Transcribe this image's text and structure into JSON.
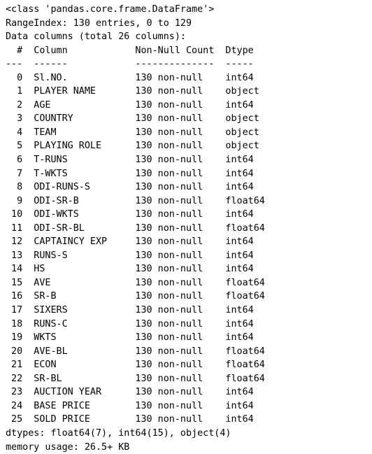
{
  "output": {
    "kind": "pandas-dataframe-info",
    "class_line": "<class 'pandas.core.frame.DataFrame'>",
    "range_index_line": "RangeIndex: 130 entries, 0 to 129",
    "data_columns_line": "Data columns (total 26 columns):",
    "entries_count": 130,
    "index_start": 0,
    "index_end": 129,
    "total_columns": 26,
    "headers": {
      "index": "#",
      "column": "Column",
      "non_null_count": "Non-Null Count",
      "dtype": "Dtype"
    },
    "header_rules": {
      "index": "---",
      "column": "------",
      "non_null_count": "--------------",
      "dtype": "-----"
    },
    "columns": [
      {
        "index": "0",
        "name": "Sl.NO.",
        "non_null": "130 non-null",
        "dtype": "int64"
      },
      {
        "index": "1",
        "name": "PLAYER NAME",
        "non_null": "130 non-null",
        "dtype": "object"
      },
      {
        "index": "2",
        "name": "AGE",
        "non_null": "130 non-null",
        "dtype": "int64"
      },
      {
        "index": "3",
        "name": "COUNTRY",
        "non_null": "130 non-null",
        "dtype": "object"
      },
      {
        "index": "4",
        "name": "TEAM",
        "non_null": "130 non-null",
        "dtype": "object"
      },
      {
        "index": "5",
        "name": "PLAYING ROLE",
        "non_null": "130 non-null",
        "dtype": "object"
      },
      {
        "index": "6",
        "name": "T-RUNS",
        "non_null": "130 non-null",
        "dtype": "int64"
      },
      {
        "index": "7",
        "name": "T-WKTS",
        "non_null": "130 non-null",
        "dtype": "int64"
      },
      {
        "index": "8",
        "name": "ODI-RUNS-S",
        "non_null": "130 non-null",
        "dtype": "int64"
      },
      {
        "index": "9",
        "name": "ODI-SR-B",
        "non_null": "130 non-null",
        "dtype": "float64"
      },
      {
        "index": "10",
        "name": "ODI-WKTS",
        "non_null": "130 non-null",
        "dtype": "int64"
      },
      {
        "index": "11",
        "name": "ODI-SR-BL",
        "non_null": "130 non-null",
        "dtype": "float64"
      },
      {
        "index": "12",
        "name": "CAPTAINCY EXP",
        "non_null": "130 non-null",
        "dtype": "int64"
      },
      {
        "index": "13",
        "name": "RUNS-S",
        "non_null": "130 non-null",
        "dtype": "int64"
      },
      {
        "index": "14",
        "name": "HS",
        "non_null": "130 non-null",
        "dtype": "int64"
      },
      {
        "index": "15",
        "name": "AVE",
        "non_null": "130 non-null",
        "dtype": "float64"
      },
      {
        "index": "16",
        "name": "SR-B",
        "non_null": "130 non-null",
        "dtype": "float64"
      },
      {
        "index": "17",
        "name": "SIXERS",
        "non_null": "130 non-null",
        "dtype": "int64"
      },
      {
        "index": "18",
        "name": "RUNS-C",
        "non_null": "130 non-null",
        "dtype": "int64"
      },
      {
        "index": "19",
        "name": "WKTS",
        "non_null": "130 non-null",
        "dtype": "int64"
      },
      {
        "index": "20",
        "name": "AVE-BL",
        "non_null": "130 non-null",
        "dtype": "float64"
      },
      {
        "index": "21",
        "name": "ECON",
        "non_null": "130 non-null",
        "dtype": "float64"
      },
      {
        "index": "22",
        "name": "SR-BL",
        "non_null": "130 non-null",
        "dtype": "float64"
      },
      {
        "index": "23",
        "name": "AUCTION YEAR",
        "non_null": "130 non-null",
        "dtype": "int64"
      },
      {
        "index": "24",
        "name": "BASE PRICE",
        "non_null": "130 non-null",
        "dtype": "int64"
      },
      {
        "index": "25",
        "name": "SOLD PRICE",
        "non_null": "130 non-null",
        "dtype": "int64"
      }
    ],
    "dtypes_line": "dtypes: float64(7), int64(15), object(4)",
    "memory_usage_line": "memory usage: 26.5+ KB",
    "dtype_counts": {
      "float64": 7,
      "int64": 15,
      "object": 4
    },
    "memory_usage": "26.5+ KB"
  },
  "style": {
    "background": "#ffffff",
    "text_color": "#000000"
  }
}
